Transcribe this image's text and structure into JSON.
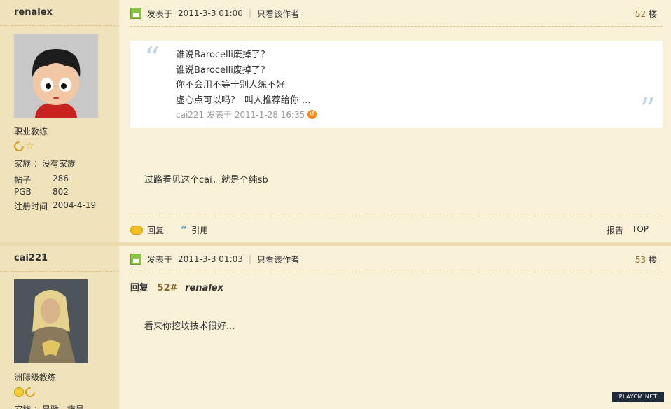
{
  "posts": [
    {
      "author": "renalex",
      "user_title": "职业教练",
      "family": "家族 ：没有家族",
      "stats": [
        {
          "k": "帖子",
          "v": "286"
        },
        {
          "k": "PGB",
          "v": "802"
        },
        {
          "k": "注册时间",
          "v": "2004-4-19"
        }
      ],
      "posted_label": "发表于",
      "posted_time": "2011-3-3 01:00",
      "author_only": "只看该作者",
      "floor_num": "52",
      "floor_unit": "楼",
      "quote": {
        "lines": [
          "谁说Barocelli废掉了?",
          "谁说Barocelli废掉了?",
          "你不会用不等于别人练不好",
          "虚心点可以吗?　叫人推荐给你 ..."
        ],
        "meta": "cai221 发表于 2011-1-28 16:35"
      },
      "body": "过路看见这个cai．就是个纯sb",
      "reply_label": "回复",
      "cite_label": "引用",
      "report_label": "报告",
      "top_label": "TOP"
    },
    {
      "author": "cai221",
      "user_title": "洲际级教练",
      "family": "家族 ：暴雅…族员",
      "posted_label": "发表于",
      "posted_time": "2011-3-3 01:03",
      "author_only": "只看该作者",
      "floor_num": "53",
      "floor_unit": "楼",
      "reply_ref": {
        "label": "回复",
        "num": "52#",
        "user": "renalex"
      },
      "body": "看来你挖坟技术很好..."
    }
  ],
  "watermark": "PLAYCM.NET",
  "colors": {
    "page_bg": "#f9f0d8",
    "sidebar_bg": "#f0e3bc",
    "accent": "#8a6a2a"
  }
}
